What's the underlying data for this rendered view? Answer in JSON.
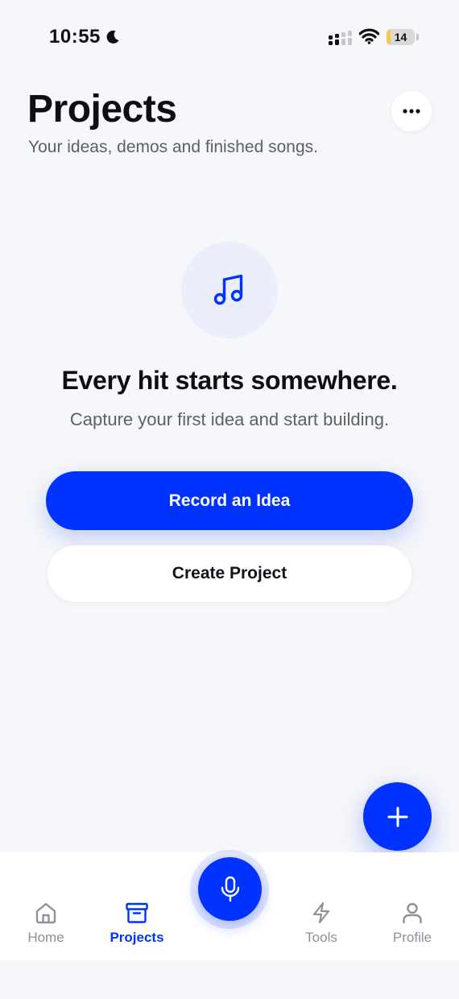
{
  "status_bar": {
    "time": "10:55",
    "battery_level": "14",
    "battery_fraction": 0.14
  },
  "header": {
    "title": "Projects",
    "subtitle": "Your ideas, demos and finished songs.",
    "more_icon": "more-horizontal-icon"
  },
  "empty_state": {
    "icon": "music-note-icon",
    "title": "Every hit starts somewhere.",
    "subtitle": "Capture your first idea and start building.",
    "primary_button": "Record an Idea",
    "secondary_button": "Create Project"
  },
  "fab": {
    "icon": "plus-icon"
  },
  "bottom_nav": {
    "items": [
      {
        "label": "Home",
        "icon": "home-icon",
        "active": false
      },
      {
        "label": "Projects",
        "icon": "archive-box-icon",
        "active": true
      },
      {
        "label": "Tools",
        "icon": "lightning-icon",
        "active": false
      },
      {
        "label": "Profile",
        "icon": "user-icon",
        "active": false
      }
    ],
    "center_icon": "microphone-icon"
  },
  "colors": {
    "accent": "#0033ff",
    "background": "#f6f7fa",
    "text_primary": "#0e0f13",
    "text_secondary": "#5c606b",
    "nav_inactive": "#8d919b",
    "icon_circle": "#ebeffb",
    "battery_fill": "#f2c94c"
  }
}
